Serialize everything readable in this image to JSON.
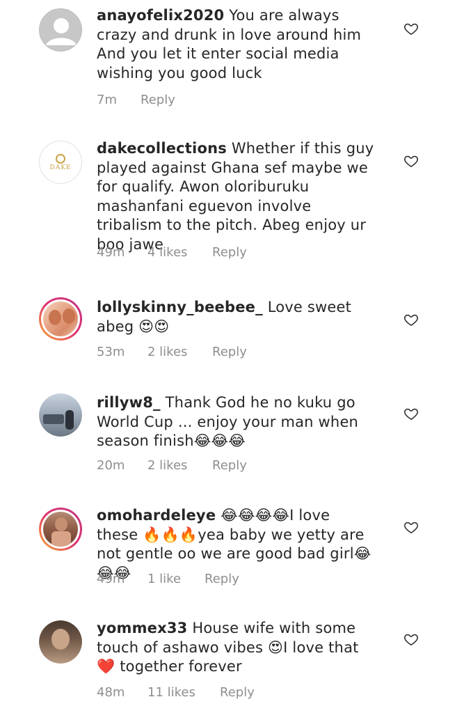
{
  "comments": [
    {
      "username": "anayofelix2020",
      "text": "You are always crazy and drunk in love around him And you let it enter social media wishing  you good luck",
      "time": "7m",
      "likes": "",
      "reply": "Reply",
      "avatar": "default-avatar"
    },
    {
      "username": "dakecollections",
      "text": "Whether if this guy played against Ghana sef maybe we for qualify. Awon oloriburuku mashanfani eguevon involve tribalism to the pitch. Abeg enjoy ur boo jawe",
      "time": "49m",
      "likes": "4 likes",
      "reply": "Reply",
      "avatar": "dake-logo",
      "logo_text": "DAKE"
    },
    {
      "username": "lollyskinny_beebee_",
      "text": "Love sweet abeg 😍😍",
      "time": "53m",
      "likes": "2 likes",
      "reply": "Reply",
      "avatar": "photo"
    },
    {
      "username": "rillyw8_",
      "text": "Thank God he no kuku go World Cup ... enjoy your man when season finish😂😂😂",
      "time": "20m",
      "likes": "2 likes",
      "reply": "Reply",
      "avatar": "photo"
    },
    {
      "username": "omohardeleye",
      "text": "😂😂😂😂I love these 🔥🔥🔥yea baby we yetty are not gentle oo we are good bad girl😂😂😂",
      "time": "49m",
      "likes": "1 like",
      "reply": "Reply",
      "avatar": "photo"
    },
    {
      "username": "yommex33",
      "text": "House wife with some touch of ashawo vibes 😍I love that❤️ together forever",
      "time": "48m",
      "likes": "11 likes",
      "reply": "Reply",
      "avatar": "photo"
    }
  ],
  "icons": {
    "like": "heart-outline-icon"
  },
  "colors": {
    "text": "#262626",
    "meta": "#8e8e8e",
    "ring": "#e1306c"
  }
}
